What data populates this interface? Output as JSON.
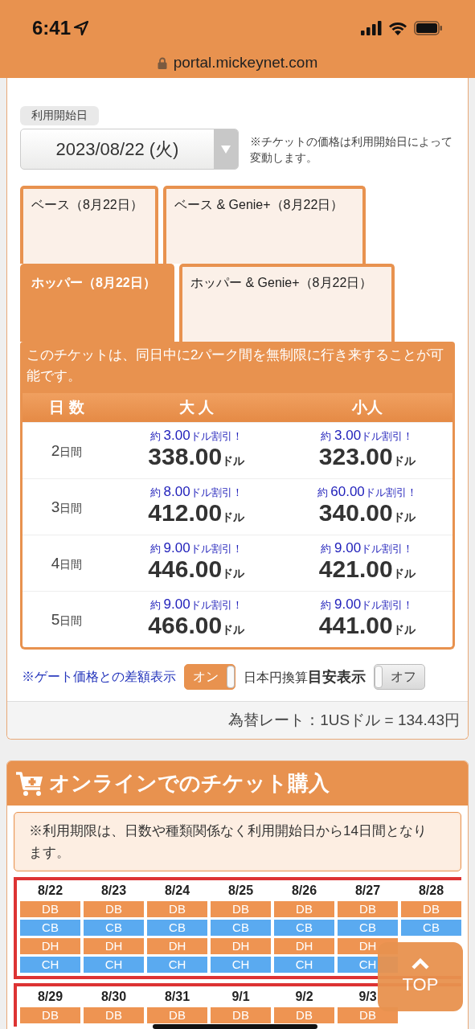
{
  "status_bar": {
    "time": "6:41"
  },
  "browser": {
    "url": "portal.mickeynet.com"
  },
  "date_picker": {
    "label": "利用開始日",
    "value": "2023/08/22 (火)",
    "note": "※チケットの価格は利用開始日によって変動します。"
  },
  "ticket_tabs": [
    {
      "label": "ベース（8月22日）",
      "selected": false
    },
    {
      "label": "ベース & Genie+（8月22日）",
      "selected": false
    },
    {
      "label": "ホッパー（8月22日）",
      "selected": true
    },
    {
      "label": "ホッパー & Genie+（8月22日）",
      "selected": false
    }
  ],
  "description": "このチケットは、同日中に2パーク間を無制限に行き来することが可能です。",
  "price_table": {
    "columns": [
      "日 数",
      "大 人",
      "小人"
    ],
    "rows": [
      {
        "days": {
          "number": "2",
          "unit": "日間"
        },
        "adult": {
          "discount": {
            "prefix": "約",
            "amount": "3.00",
            "suffix": "ドル割引！"
          },
          "price": "338.00",
          "unit": "ドル"
        },
        "child": {
          "discount": {
            "prefix": "約",
            "amount": "3.00",
            "suffix": "ドル割引！"
          },
          "price": "323.00",
          "unit": "ドル"
        }
      },
      {
        "days": {
          "number": "3",
          "unit": "日間"
        },
        "adult": {
          "discount": {
            "prefix": "約",
            "amount": "8.00",
            "suffix": "ドル割引！"
          },
          "price": "412.00",
          "unit": "ドル"
        },
        "child": {
          "discount": {
            "prefix": "約",
            "amount": "60.00",
            "suffix": "ドル割引！"
          },
          "price": "340.00",
          "unit": "ドル"
        }
      },
      {
        "days": {
          "number": "4",
          "unit": "日間"
        },
        "adult": {
          "discount": {
            "prefix": "約",
            "amount": "9.00",
            "suffix": "ドル割引！"
          },
          "price": "446.00",
          "unit": "ドル"
        },
        "child": {
          "discount": {
            "prefix": "約",
            "amount": "9.00",
            "suffix": "ドル割引！"
          },
          "price": "421.00",
          "unit": "ドル"
        }
      },
      {
        "days": {
          "number": "5",
          "unit": "日間"
        },
        "adult": {
          "discount": {
            "prefix": "約",
            "amount": "9.00",
            "suffix": "ドル割引！"
          },
          "price": "466.00",
          "unit": "ドル"
        },
        "child": {
          "discount": {
            "prefix": "約",
            "amount": "9.00",
            "suffix": "ドル割引！"
          },
          "price": "441.00",
          "unit": "ドル"
        }
      }
    ]
  },
  "toggles": [
    {
      "label": "※ゲート価格との差額表示",
      "kind": "link",
      "switch": "オン",
      "on": true
    },
    {
      "label": "日本円換算**目安表示**",
      "kind": "text",
      "switch": "オフ",
      "on": false
    }
  ],
  "exchange_rate": "為替レート：1USドル = 134.43円",
  "purchase": {
    "title": "オンラインでのチケット購入",
    "notice": "※利用期限は、日数や種類関係なく利用開始日から14日間となります。",
    "weeks": [
      {
        "dates": [
          "8/22",
          "8/23",
          "8/24",
          "8/25",
          "8/26",
          "8/27",
          "8/28"
        ],
        "rows": [
          {
            "color": "#ee9452",
            "cells": [
              "DB",
              "DB",
              "DB",
              "DB",
              "DB",
              "DB",
              "DB"
            ]
          },
          {
            "color": "#5aaaf0",
            "cells": [
              "CB",
              "CB",
              "CB",
              "CB",
              "CB",
              "CB",
              "CB"
            ]
          },
          {
            "color": "#ee9452",
            "cells": [
              "DH",
              "DH",
              "DH",
              "DH",
              "DH",
              "DH"
            ]
          },
          {
            "color": "#5aaaf0",
            "cells": [
              "CH",
              "CH",
              "CH",
              "CH",
              "CH",
              "CH"
            ]
          }
        ]
      },
      {
        "dates": [
          "8/29",
          "8/30",
          "8/31",
          "9/1",
          "9/2",
          "9/3"
        ],
        "rows": [
          {
            "color": "#ee9452",
            "cells": [
              "DB",
              "DB",
              "DB",
              "DB",
              "DB",
              "DB"
            ]
          }
        ]
      }
    ]
  },
  "top_button": {
    "label": "TOP"
  }
}
